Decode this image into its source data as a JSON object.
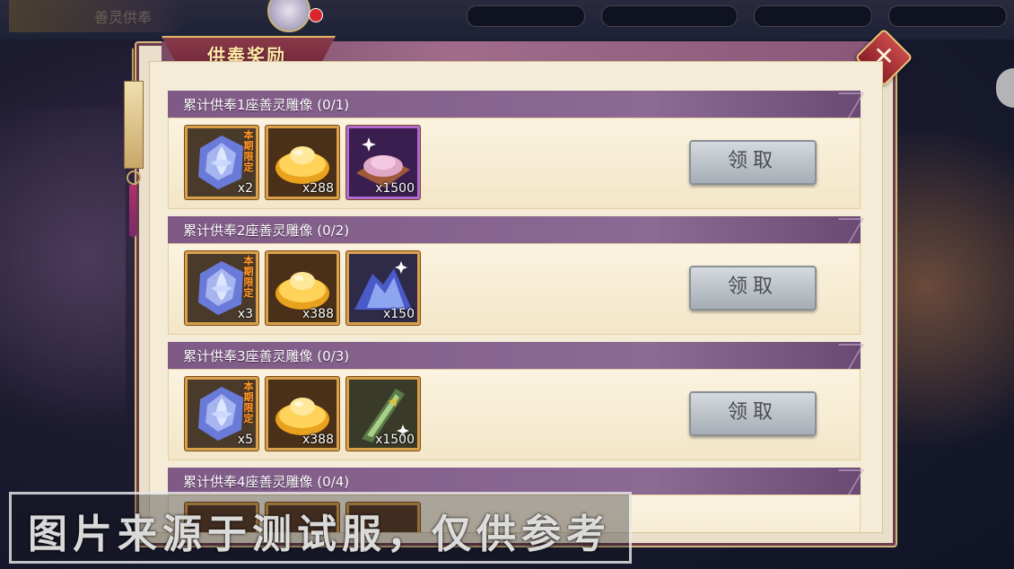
{
  "header": {
    "title": "供奉奖励",
    "close_icon": "close-x-icon",
    "background_tab_label": "善灵供奉"
  },
  "rows": [
    {
      "title": "累计供奉1座善灵雕像 (0/1)",
      "items": [
        {
          "icon": "blue-crystal-icon",
          "count": "x2",
          "tag": "本期限定"
        },
        {
          "icon": "gold-ingot-icon",
          "count": "x288",
          "tag": ""
        },
        {
          "icon": "purple-powder-icon",
          "count": "x1500",
          "tag": ""
        }
      ],
      "button": "领取"
    },
    {
      "title": "累计供奉2座善灵雕像 (0/2)",
      "items": [
        {
          "icon": "blue-crystal-icon",
          "count": "x3",
          "tag": "本期限定"
        },
        {
          "icon": "gold-ingot-icon",
          "count": "x388",
          "tag": ""
        },
        {
          "icon": "blue-ore-icon",
          "count": "x150",
          "tag": ""
        }
      ],
      "button": "领取"
    },
    {
      "title": "累计供奉3座善灵雕像 (0/3)",
      "items": [
        {
          "icon": "blue-crystal-icon",
          "count": "x5",
          "tag": "本期限定"
        },
        {
          "icon": "gold-ingot-icon",
          "count": "x388",
          "tag": ""
        },
        {
          "icon": "green-blade-icon",
          "count": "x1500",
          "tag": ""
        }
      ],
      "button": "领取"
    },
    {
      "title": "累计供奉4座善灵雕像 (0/4)",
      "items": [],
      "button": ""
    }
  ],
  "watermark": "图片来源于测试服，仅供参考",
  "colors": {
    "row_header": "#7f5a86",
    "item_border": "#d8a04a",
    "button": "#b8bec4"
  }
}
